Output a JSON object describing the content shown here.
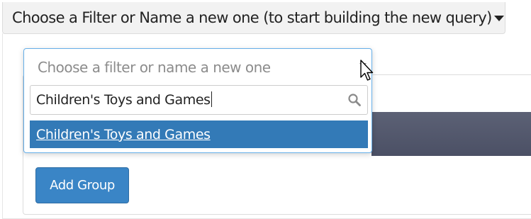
{
  "header": {
    "label": "Choose a Filter or Name a new one (to start building the new query)",
    "caret_icon": "caret-down-icon"
  },
  "filter_select": {
    "placeholder": "Choose a filter or name a new one",
    "caret_icon": "caret-down-icon",
    "search_value": "Children's Toys and Games",
    "search_icon": "search-icon",
    "options": [
      {
        "label": "Children's Toys and Games",
        "highlighted": true
      }
    ]
  },
  "actions": {
    "add_group_label": "Add Group"
  },
  "colors": {
    "accent": "#337ab7",
    "button": "#3a85c6",
    "focus_border": "#66afe9",
    "dark_band": "#4b5065"
  },
  "pointer": "mouse-pointer-icon"
}
